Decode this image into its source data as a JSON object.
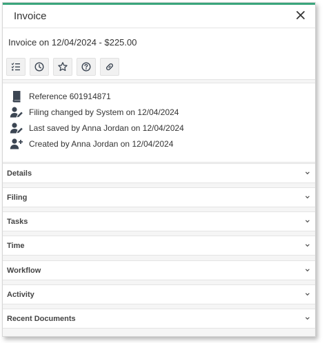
{
  "window": {
    "title": "Invoice"
  },
  "document": {
    "heading": "Invoice on 12/04/2024 - $225.00"
  },
  "toolbar": {
    "buttons": [
      {
        "icon": "checklist-icon"
      },
      {
        "icon": "clock-icon"
      },
      {
        "icon": "star-icon"
      },
      {
        "icon": "help-icon"
      },
      {
        "icon": "link-icon"
      }
    ]
  },
  "info": {
    "items": [
      {
        "icon": "book-icon",
        "text": "Reference 601914871"
      },
      {
        "icon": "user-edit-icon",
        "text": "Filing changed by System on 12/04/2024"
      },
      {
        "icon": "user-edit-icon",
        "text": "Last saved by Anna Jordan on 12/04/2024"
      },
      {
        "icon": "user-add-icon",
        "text": "Created by Anna Jordan on 12/04/2024"
      }
    ]
  },
  "sections": [
    {
      "label": "Details"
    },
    {
      "label": "Filing"
    },
    {
      "label": "Tasks"
    },
    {
      "label": "Time"
    },
    {
      "label": "Workflow"
    },
    {
      "label": "Activity"
    },
    {
      "label": "Recent Documents"
    }
  ],
  "colors": {
    "accent": "#3aa57b",
    "icon": "#3c4653"
  }
}
